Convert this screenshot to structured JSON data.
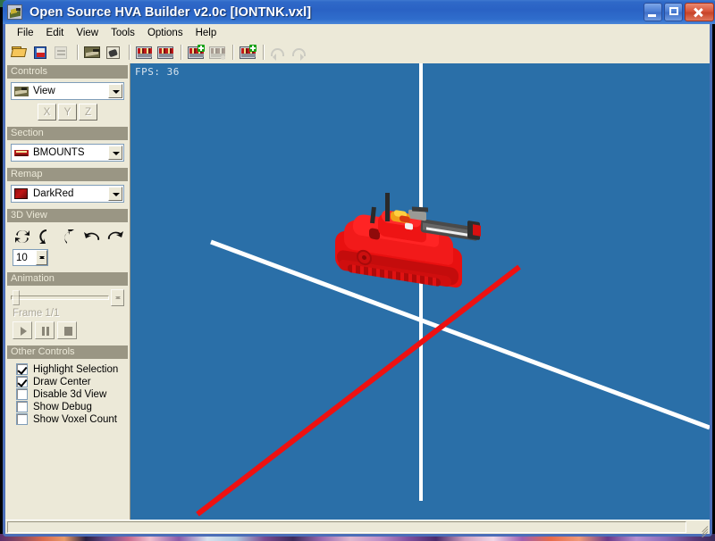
{
  "window": {
    "title": "Open Source HVA Builder v2.0c [IONTNK.vxl]",
    "app_icon": "voxel-app-icon",
    "minimize_label": "Minimize",
    "maximize_label": "Maximize",
    "close_label": "Close"
  },
  "menu": {
    "items": [
      {
        "label": "File"
      },
      {
        "label": "Edit"
      },
      {
        "label": "View"
      },
      {
        "label": "Tools"
      },
      {
        "label": "Options"
      },
      {
        "label": "Help"
      }
    ]
  },
  "toolbar": {
    "buttons": [
      {
        "name": "open-file-button",
        "icon": "open-folder-icon",
        "enabled": true
      },
      {
        "name": "save-file-button",
        "icon": "floppy-disk-icon",
        "enabled": true
      },
      {
        "name": "save-as-button",
        "icon": "save-as-icon",
        "enabled": false
      },
      {
        "name": "load-vxl-button",
        "icon": "voxel-model-icon",
        "enabled": true
      },
      {
        "name": "load-hva-button",
        "icon": "hva-animation-icon",
        "enabled": true
      },
      {
        "name": "section-button",
        "icon": "section-icon",
        "enabled": true
      },
      {
        "name": "section-copy-button",
        "icon": "section-copy-icon",
        "enabled": true
      },
      {
        "name": "section-add-button",
        "icon": "section-add-icon",
        "enabled": true
      },
      {
        "name": "section-remove-button",
        "icon": "section-remove-icon",
        "enabled": false
      },
      {
        "name": "section-new-button",
        "icon": "section-new-icon",
        "enabled": true
      },
      {
        "name": "undo-button",
        "icon": "undo-icon",
        "enabled": false
      },
      {
        "name": "redo-button",
        "icon": "redo-icon",
        "enabled": false
      }
    ]
  },
  "sidebar": {
    "controls": {
      "group_label": "Controls",
      "mode_combo": {
        "value": "View",
        "icon": "voxel-view-icon"
      },
      "axis_buttons": [
        {
          "label": "X"
        },
        {
          "label": "Y"
        },
        {
          "label": "Z"
        }
      ]
    },
    "section": {
      "group_label": "Section",
      "combo": {
        "value": "BMOUNTS",
        "icon": "section-swatch-icon"
      }
    },
    "remap": {
      "group_label": "Remap",
      "combo": {
        "value": "DarkRed",
        "icon": "color-swatch-icon",
        "color": "#9e1111"
      }
    },
    "view3d": {
      "group_label": "3D View",
      "rotate_buttons": [
        {
          "name": "rotate-reset-icon"
        },
        {
          "name": "rotate-left-icon"
        },
        {
          "name": "rotate-up-icon"
        },
        {
          "name": "rotate-ccw-icon"
        },
        {
          "name": "rotate-cw-icon"
        }
      ],
      "step_spinner": {
        "value": "10"
      }
    },
    "animation": {
      "group_label": "Animation",
      "frame_label": "Frame 1/1",
      "slider_value": 0,
      "playback": [
        {
          "name": "play-button",
          "icon": "play-icon"
        },
        {
          "name": "pause-button",
          "icon": "pause-icon"
        },
        {
          "name": "stop-button",
          "icon": "stop-icon"
        }
      ]
    },
    "other_controls": {
      "group_label": "Other Controls",
      "checkboxes": [
        {
          "label": "Highlight Selection",
          "checked": true
        },
        {
          "label": "Draw Center",
          "checked": true
        },
        {
          "label": "Disable 3d View",
          "checked": false
        },
        {
          "label": "Show Debug",
          "checked": false
        },
        {
          "label": "Show Voxel Count",
          "checked": false
        }
      ]
    }
  },
  "viewport": {
    "fps_text": "FPS: 36",
    "background_color": "#2a6fa8",
    "axis_colors": {
      "vertical": "#ffffff",
      "horizontal": "#ffffff",
      "depth": "#ee1111"
    },
    "model_name": "IONTNK voxel tank"
  },
  "statusbar": {
    "text": ""
  }
}
